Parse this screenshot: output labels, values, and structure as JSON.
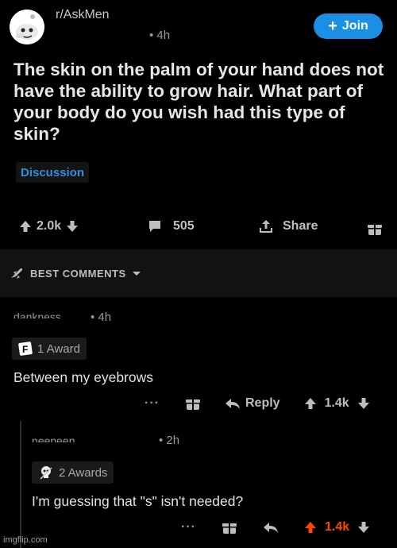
{
  "post": {
    "subreddit": "r/AskMen",
    "time": "• 4h",
    "join_label": "Join",
    "title": "The skin on the palm of your hand does not have the ability to grow hair. What part of your body do you wish had this type of skin?",
    "flair": "Discussion",
    "votes": "2.0k",
    "comments": "505",
    "share_label": "Share"
  },
  "sort": {
    "label": "BEST COMMENTS"
  },
  "comments": [
    {
      "author": "dankness",
      "time": "• 4h",
      "award_label": "1 Award",
      "text": "Between my eyebrows",
      "more": "···",
      "reply_label": "Reply",
      "votes": "1.4k"
    },
    {
      "author": "neeneen",
      "time": "• 2h",
      "award_label": "2 Awards",
      "text": "I'm guessing that \"s\" isn't needed?",
      "more": "···",
      "votes": "1.4k"
    }
  ],
  "watermark": "imgflip.com",
  "colors": {
    "accent": "#1a8fe3",
    "flair": "#2f8ee0",
    "upvoted": "#ff4500",
    "background": "#000000"
  }
}
